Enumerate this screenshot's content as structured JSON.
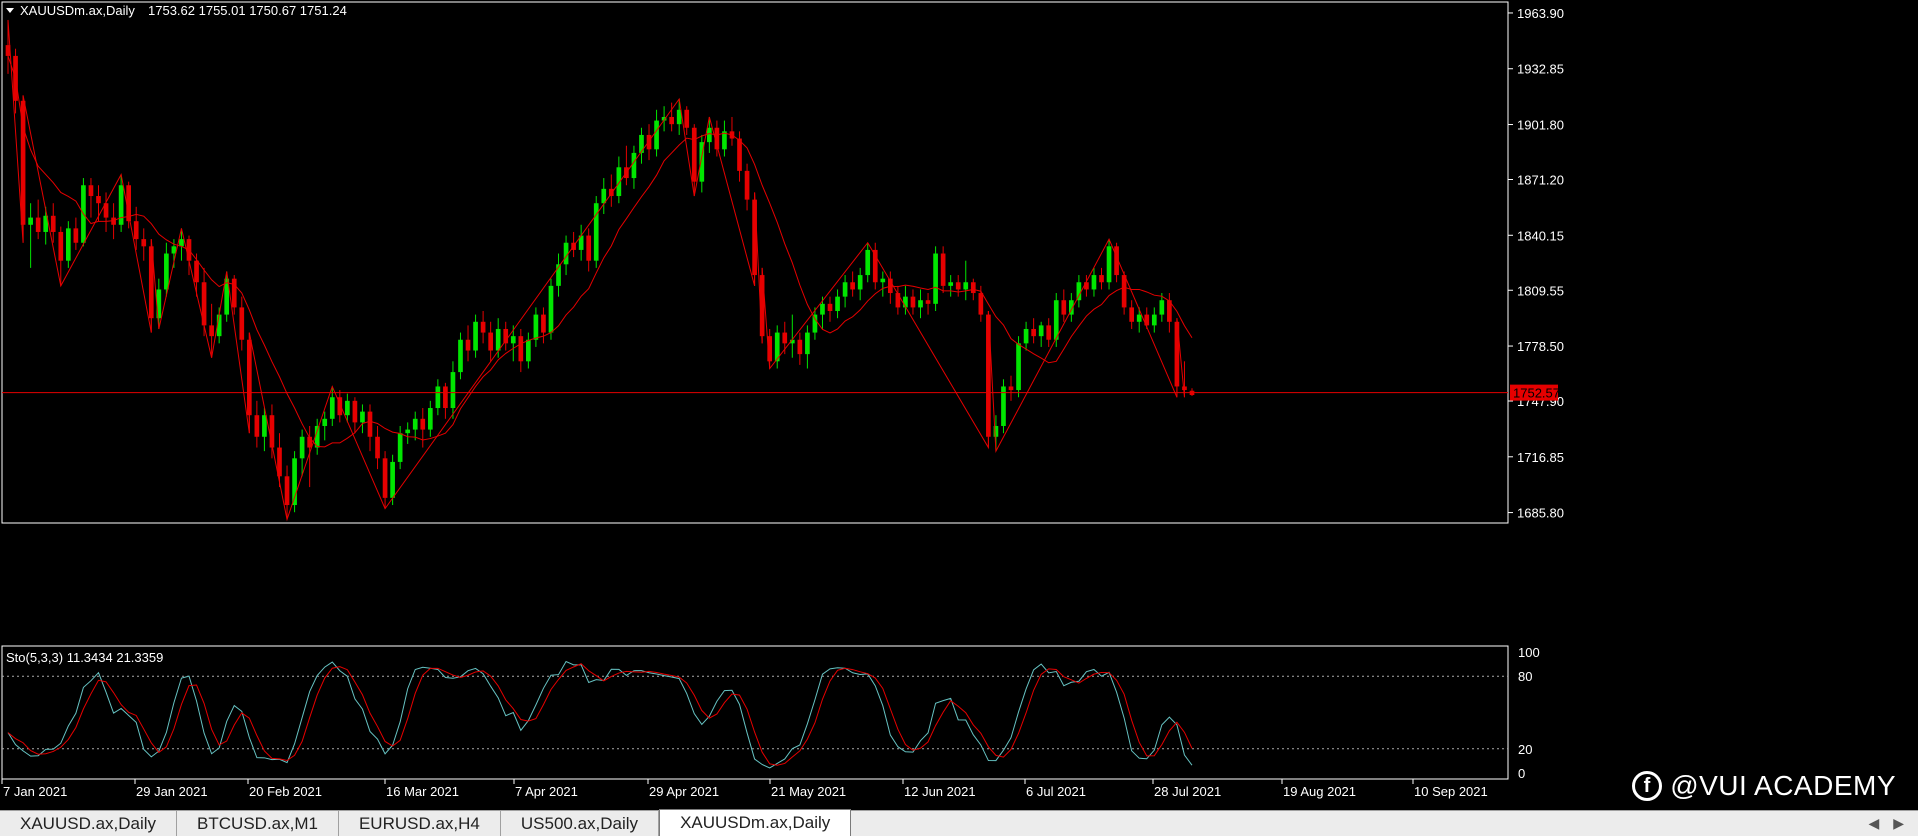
{
  "main_header": {
    "symbol_label": "XAUUSDm.ax,Daily",
    "ohlc": "1753.62 1755.01 1750.67 1751.24"
  },
  "price_axis": [
    "1963.90",
    "1932.85",
    "1901.80",
    "1871.20",
    "1840.15",
    "1809.55",
    "1778.50",
    "1747.90",
    "1716.85",
    "1685.80"
  ],
  "current_price": "1752.57",
  "date_axis": [
    "7 Jan 2021",
    "29 Jan 2021",
    "20 Feb 2021",
    "16 Mar 2021",
    "7 Apr 2021",
    "29 Apr 2021",
    "21 May 2021",
    "12 Jun 2021",
    "6 Jul 2021",
    "28 Jul 2021",
    "19 Aug 2021",
    "10 Sep 2021"
  ],
  "stochastic": {
    "label": "Sto(5,3,3) 11.3434 21.3359",
    "levels": [
      "100",
      "80",
      "20",
      "0"
    ]
  },
  "tabs": [
    {
      "label": "XAUUSD.ax,Daily",
      "active": false
    },
    {
      "label": "BTCUSD.ax,M1",
      "active": false
    },
    {
      "label": "EURUSD.ax,H4",
      "active": false
    },
    {
      "label": "US500.ax,Daily",
      "active": false
    },
    {
      "label": "XAUUSDm.ax,Daily",
      "active": true
    }
  ],
  "watermark": "@VUI ACADEMY",
  "colors": {
    "bull": "#00e600",
    "bear": "#e60000",
    "ma": "#e60000",
    "stoK": "#66c2c2",
    "stoD": "#e60000",
    "axis": "#ffffff"
  },
  "chart_data": {
    "type": "candlestick",
    "instrument": "XAUUSDm.ax",
    "timeframe": "Daily",
    "ylim": [
      1680,
      1970
    ],
    "candles": [
      {
        "o": 1946,
        "h": 1960,
        "l": 1930,
        "c": 1940
      },
      {
        "o": 1940,
        "h": 1944,
        "l": 1908,
        "c": 1915
      },
      {
        "o": 1915,
        "h": 1918,
        "l": 1836,
        "c": 1846
      },
      {
        "o": 1846,
        "h": 1858,
        "l": 1822,
        "c": 1850
      },
      {
        "o": 1850,
        "h": 1860,
        "l": 1838,
        "c": 1842
      },
      {
        "o": 1842,
        "h": 1856,
        "l": 1835,
        "c": 1851
      },
      {
        "o": 1851,
        "h": 1858,
        "l": 1836,
        "c": 1842
      },
      {
        "o": 1842,
        "h": 1845,
        "l": 1812,
        "c": 1826
      },
      {
        "o": 1826,
        "h": 1848,
        "l": 1822,
        "c": 1844
      },
      {
        "o": 1844,
        "h": 1850,
        "l": 1832,
        "c": 1836
      },
      {
        "o": 1836,
        "h": 1872,
        "l": 1834,
        "c": 1868
      },
      {
        "o": 1868,
        "h": 1872,
        "l": 1850,
        "c": 1862
      },
      {
        "o": 1862,
        "h": 1868,
        "l": 1848,
        "c": 1858
      },
      {
        "o": 1858,
        "h": 1864,
        "l": 1842,
        "c": 1850
      },
      {
        "o": 1850,
        "h": 1858,
        "l": 1838,
        "c": 1846
      },
      {
        "o": 1846,
        "h": 1874,
        "l": 1842,
        "c": 1868
      },
      {
        "o": 1868,
        "h": 1870,
        "l": 1844,
        "c": 1848
      },
      {
        "o": 1848,
        "h": 1856,
        "l": 1832,
        "c": 1838
      },
      {
        "o": 1838,
        "h": 1844,
        "l": 1826,
        "c": 1834
      },
      {
        "o": 1834,
        "h": 1838,
        "l": 1786,
        "c": 1794
      },
      {
        "o": 1794,
        "h": 1816,
        "l": 1788,
        "c": 1810
      },
      {
        "o": 1810,
        "h": 1836,
        "l": 1806,
        "c": 1830
      },
      {
        "o": 1830,
        "h": 1838,
        "l": 1822,
        "c": 1834
      },
      {
        "o": 1834,
        "h": 1844,
        "l": 1826,
        "c": 1838
      },
      {
        "o": 1838,
        "h": 1840,
        "l": 1818,
        "c": 1826
      },
      {
        "o": 1826,
        "h": 1830,
        "l": 1806,
        "c": 1814
      },
      {
        "o": 1814,
        "h": 1822,
        "l": 1784,
        "c": 1790
      },
      {
        "o": 1790,
        "h": 1802,
        "l": 1772,
        "c": 1784
      },
      {
        "o": 1784,
        "h": 1800,
        "l": 1780,
        "c": 1796
      },
      {
        "o": 1796,
        "h": 1820,
        "l": 1792,
        "c": 1816
      },
      {
        "o": 1816,
        "h": 1818,
        "l": 1796,
        "c": 1800
      },
      {
        "o": 1800,
        "h": 1806,
        "l": 1776,
        "c": 1782
      },
      {
        "o": 1782,
        "h": 1786,
        "l": 1730,
        "c": 1740
      },
      {
        "o": 1740,
        "h": 1748,
        "l": 1722,
        "c": 1728
      },
      {
        "o": 1728,
        "h": 1744,
        "l": 1720,
        "c": 1740
      },
      {
        "o": 1740,
        "h": 1746,
        "l": 1716,
        "c": 1722
      },
      {
        "o": 1722,
        "h": 1730,
        "l": 1700,
        "c": 1706
      },
      {
        "o": 1706,
        "h": 1712,
        "l": 1682,
        "c": 1690
      },
      {
        "o": 1690,
        "h": 1720,
        "l": 1686,
        "c": 1716
      },
      {
        "o": 1716,
        "h": 1732,
        "l": 1706,
        "c": 1728
      },
      {
        "o": 1728,
        "h": 1734,
        "l": 1700,
        "c": 1722
      },
      {
        "o": 1722,
        "h": 1738,
        "l": 1718,
        "c": 1734
      },
      {
        "o": 1734,
        "h": 1742,
        "l": 1726,
        "c": 1738
      },
      {
        "o": 1738,
        "h": 1756,
        "l": 1734,
        "c": 1750
      },
      {
        "o": 1750,
        "h": 1754,
        "l": 1736,
        "c": 1740
      },
      {
        "o": 1740,
        "h": 1752,
        "l": 1736,
        "c": 1748
      },
      {
        "o": 1748,
        "h": 1750,
        "l": 1730,
        "c": 1736
      },
      {
        "o": 1736,
        "h": 1746,
        "l": 1730,
        "c": 1742
      },
      {
        "o": 1742,
        "h": 1746,
        "l": 1720,
        "c": 1728
      },
      {
        "o": 1728,
        "h": 1734,
        "l": 1710,
        "c": 1716
      },
      {
        "o": 1716,
        "h": 1720,
        "l": 1688,
        "c": 1694
      },
      {
        "o": 1694,
        "h": 1718,
        "l": 1690,
        "c": 1714
      },
      {
        "o": 1714,
        "h": 1734,
        "l": 1710,
        "c": 1730
      },
      {
        "o": 1730,
        "h": 1736,
        "l": 1724,
        "c": 1732
      },
      {
        "o": 1732,
        "h": 1742,
        "l": 1726,
        "c": 1738
      },
      {
        "o": 1738,
        "h": 1744,
        "l": 1722,
        "c": 1732
      },
      {
        "o": 1732,
        "h": 1748,
        "l": 1728,
        "c": 1744
      },
      {
        "o": 1744,
        "h": 1760,
        "l": 1740,
        "c": 1756
      },
      {
        "o": 1756,
        "h": 1758,
        "l": 1738,
        "c": 1744
      },
      {
        "o": 1744,
        "h": 1770,
        "l": 1738,
        "c": 1764
      },
      {
        "o": 1764,
        "h": 1786,
        "l": 1760,
        "c": 1782
      },
      {
        "o": 1782,
        "h": 1790,
        "l": 1770,
        "c": 1776
      },
      {
        "o": 1776,
        "h": 1796,
        "l": 1772,
        "c": 1792
      },
      {
        "o": 1792,
        "h": 1798,
        "l": 1780,
        "c": 1786
      },
      {
        "o": 1786,
        "h": 1792,
        "l": 1770,
        "c": 1776
      },
      {
        "o": 1776,
        "h": 1794,
        "l": 1772,
        "c": 1788
      },
      {
        "o": 1788,
        "h": 1792,
        "l": 1776,
        "c": 1780
      },
      {
        "o": 1780,
        "h": 1790,
        "l": 1770,
        "c": 1784
      },
      {
        "o": 1784,
        "h": 1788,
        "l": 1764,
        "c": 1770
      },
      {
        "o": 1770,
        "h": 1786,
        "l": 1766,
        "c": 1782
      },
      {
        "o": 1782,
        "h": 1800,
        "l": 1778,
        "c": 1796
      },
      {
        "o": 1796,
        "h": 1800,
        "l": 1780,
        "c": 1786
      },
      {
        "o": 1786,
        "h": 1816,
        "l": 1782,
        "c": 1812
      },
      {
        "o": 1812,
        "h": 1830,
        "l": 1806,
        "c": 1824
      },
      {
        "o": 1824,
        "h": 1840,
        "l": 1818,
        "c": 1836
      },
      {
        "o": 1836,
        "h": 1842,
        "l": 1828,
        "c": 1832
      },
      {
        "o": 1832,
        "h": 1846,
        "l": 1826,
        "c": 1840
      },
      {
        "o": 1840,
        "h": 1844,
        "l": 1820,
        "c": 1826
      },
      {
        "o": 1826,
        "h": 1862,
        "l": 1822,
        "c": 1858
      },
      {
        "o": 1858,
        "h": 1872,
        "l": 1852,
        "c": 1866
      },
      {
        "o": 1866,
        "h": 1874,
        "l": 1856,
        "c": 1862
      },
      {
        "o": 1862,
        "h": 1884,
        "l": 1858,
        "c": 1878
      },
      {
        "o": 1878,
        "h": 1890,
        "l": 1868,
        "c": 1872
      },
      {
        "o": 1872,
        "h": 1890,
        "l": 1866,
        "c": 1886
      },
      {
        "o": 1886,
        "h": 1900,
        "l": 1880,
        "c": 1896
      },
      {
        "o": 1896,
        "h": 1902,
        "l": 1882,
        "c": 1888
      },
      {
        "o": 1888,
        "h": 1910,
        "l": 1884,
        "c": 1904
      },
      {
        "o": 1904,
        "h": 1912,
        "l": 1898,
        "c": 1906
      },
      {
        "o": 1906,
        "h": 1914,
        "l": 1898,
        "c": 1902
      },
      {
        "o": 1902,
        "h": 1916,
        "l": 1896,
        "c": 1910
      },
      {
        "o": 1910,
        "h": 1912,
        "l": 1896,
        "c": 1900
      },
      {
        "o": 1900,
        "h": 1902,
        "l": 1862,
        "c": 1870
      },
      {
        "o": 1870,
        "h": 1896,
        "l": 1864,
        "c": 1892
      },
      {
        "o": 1892,
        "h": 1906,
        "l": 1886,
        "c": 1900
      },
      {
        "o": 1900,
        "h": 1904,
        "l": 1884,
        "c": 1888
      },
      {
        "o": 1888,
        "h": 1904,
        "l": 1884,
        "c": 1898
      },
      {
        "o": 1898,
        "h": 1906,
        "l": 1890,
        "c": 1894
      },
      {
        "o": 1894,
        "h": 1898,
        "l": 1870,
        "c": 1876
      },
      {
        "o": 1876,
        "h": 1880,
        "l": 1854,
        "c": 1860
      },
      {
        "o": 1860,
        "h": 1864,
        "l": 1812,
        "c": 1818
      },
      {
        "o": 1818,
        "h": 1822,
        "l": 1780,
        "c": 1784
      },
      {
        "o": 1784,
        "h": 1788,
        "l": 1766,
        "c": 1770
      },
      {
        "o": 1770,
        "h": 1790,
        "l": 1766,
        "c": 1786
      },
      {
        "o": 1786,
        "h": 1792,
        "l": 1774,
        "c": 1780
      },
      {
        "o": 1780,
        "h": 1796,
        "l": 1772,
        "c": 1782
      },
      {
        "o": 1782,
        "h": 1786,
        "l": 1768,
        "c": 1774
      },
      {
        "o": 1774,
        "h": 1790,
        "l": 1766,
        "c": 1786
      },
      {
        "o": 1786,
        "h": 1800,
        "l": 1782,
        "c": 1796
      },
      {
        "o": 1796,
        "h": 1806,
        "l": 1788,
        "c": 1802
      },
      {
        "o": 1802,
        "h": 1806,
        "l": 1792,
        "c": 1798
      },
      {
        "o": 1798,
        "h": 1810,
        "l": 1794,
        "c": 1806
      },
      {
        "o": 1806,
        "h": 1818,
        "l": 1800,
        "c": 1814
      },
      {
        "o": 1814,
        "h": 1820,
        "l": 1806,
        "c": 1810
      },
      {
        "o": 1810,
        "h": 1822,
        "l": 1804,
        "c": 1818
      },
      {
        "o": 1818,
        "h": 1836,
        "l": 1814,
        "c": 1832
      },
      {
        "o": 1832,
        "h": 1836,
        "l": 1810,
        "c": 1814
      },
      {
        "o": 1814,
        "h": 1820,
        "l": 1806,
        "c": 1816
      },
      {
        "o": 1816,
        "h": 1820,
        "l": 1802,
        "c": 1808
      },
      {
        "o": 1808,
        "h": 1812,
        "l": 1796,
        "c": 1800
      },
      {
        "o": 1800,
        "h": 1812,
        "l": 1796,
        "c": 1806
      },
      {
        "o": 1806,
        "h": 1810,
        "l": 1796,
        "c": 1800
      },
      {
        "o": 1800,
        "h": 1810,
        "l": 1794,
        "c": 1804
      },
      {
        "o": 1804,
        "h": 1808,
        "l": 1796,
        "c": 1802
      },
      {
        "o": 1802,
        "h": 1834,
        "l": 1798,
        "c": 1830
      },
      {
        "o": 1830,
        "h": 1834,
        "l": 1808,
        "c": 1812
      },
      {
        "o": 1812,
        "h": 1818,
        "l": 1806,
        "c": 1814
      },
      {
        "o": 1814,
        "h": 1818,
        "l": 1806,
        "c": 1810
      },
      {
        "o": 1810,
        "h": 1826,
        "l": 1804,
        "c": 1814
      },
      {
        "o": 1814,
        "h": 1816,
        "l": 1804,
        "c": 1808
      },
      {
        "o": 1808,
        "h": 1812,
        "l": 1792,
        "c": 1796
      },
      {
        "o": 1796,
        "h": 1798,
        "l": 1722,
        "c": 1728
      },
      {
        "o": 1728,
        "h": 1740,
        "l": 1720,
        "c": 1734
      },
      {
        "o": 1734,
        "h": 1760,
        "l": 1730,
        "c": 1756
      },
      {
        "o": 1756,
        "h": 1762,
        "l": 1748,
        "c": 1754
      },
      {
        "o": 1754,
        "h": 1784,
        "l": 1750,
        "c": 1780
      },
      {
        "o": 1780,
        "h": 1792,
        "l": 1776,
        "c": 1788
      },
      {
        "o": 1788,
        "h": 1794,
        "l": 1780,
        "c": 1784
      },
      {
        "o": 1784,
        "h": 1792,
        "l": 1778,
        "c": 1790
      },
      {
        "o": 1790,
        "h": 1794,
        "l": 1778,
        "c": 1782
      },
      {
        "o": 1782,
        "h": 1808,
        "l": 1778,
        "c": 1804
      },
      {
        "o": 1804,
        "h": 1810,
        "l": 1792,
        "c": 1796
      },
      {
        "o": 1796,
        "h": 1808,
        "l": 1792,
        "c": 1804
      },
      {
        "o": 1804,
        "h": 1818,
        "l": 1800,
        "c": 1814
      },
      {
        "o": 1814,
        "h": 1818,
        "l": 1806,
        "c": 1810
      },
      {
        "o": 1810,
        "h": 1822,
        "l": 1806,
        "c": 1818
      },
      {
        "o": 1818,
        "h": 1822,
        "l": 1810,
        "c": 1814
      },
      {
        "o": 1814,
        "h": 1838,
        "l": 1810,
        "c": 1834
      },
      {
        "o": 1834,
        "h": 1836,
        "l": 1814,
        "c": 1818
      },
      {
        "o": 1818,
        "h": 1820,
        "l": 1796,
        "c": 1800
      },
      {
        "o": 1800,
        "h": 1804,
        "l": 1788,
        "c": 1792
      },
      {
        "o": 1792,
        "h": 1800,
        "l": 1786,
        "c": 1796
      },
      {
        "o": 1796,
        "h": 1800,
        "l": 1788,
        "c": 1790
      },
      {
        "o": 1790,
        "h": 1800,
        "l": 1786,
        "c": 1796
      },
      {
        "o": 1796,
        "h": 1808,
        "l": 1792,
        "c": 1804
      },
      {
        "o": 1804,
        "h": 1808,
        "l": 1786,
        "c": 1792
      },
      {
        "o": 1792,
        "h": 1794,
        "l": 1750,
        "c": 1756
      },
      {
        "o": 1756,
        "h": 1770,
        "l": 1750,
        "c": 1754
      },
      {
        "o": 1753.62,
        "h": 1755.01,
        "l": 1750.67,
        "c": 1751.24
      }
    ]
  }
}
